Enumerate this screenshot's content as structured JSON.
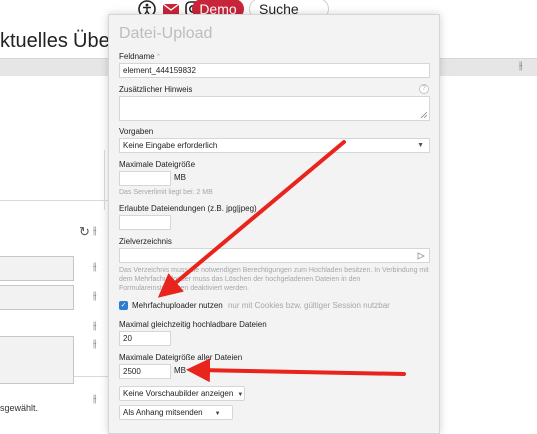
{
  "topbar": {
    "demo_label": "Demo",
    "search_label": "Suche"
  },
  "nav": {
    "item1": "ktuelles",
    "item2": "Über"
  },
  "background": {
    "selection_text": "sgewählt."
  },
  "panel": {
    "title": "Datei-Upload",
    "field_name_label": "Feldname",
    "required_mark": "*",
    "field_name_value": "element_444159832",
    "extra_hint_label": "Zusätzlicher Hinweis",
    "help_glyph": "?",
    "presets_label": "Vorgaben",
    "presets_value": "Keine Eingabe erforderlich",
    "max_size_label": "Maximale Dateigröße",
    "max_size_value": "",
    "max_size_unit": "MB",
    "server_limit_hint": "Das Serverlimit liegt bei: 2 MB",
    "extensions_label": "Erlaubte Dateiendungen (z.B. jpg|jpeg)",
    "extensions_value": "",
    "target_dir_label": "Zielverzeichnis",
    "target_dir_value": "",
    "target_dir_hint": "Das Verzeichnis muss die notwendigen Berechtigungen zum Hochladen besitzen. In Verbindung mit dem Mehrfachuploader muss das Löschen der hochgeladenen Dateien in den Formulareinstellungen deaktiviert werden.",
    "multi_upload_label": "Mehrfachuploader nutzen",
    "multi_upload_note": "nur mit Cookies bzw. gültiger Session nutzbar",
    "multi_upload_checked": true,
    "max_parallel_label": "Maximal gleichzeitig hochladbare Dateien",
    "max_parallel_value": "20",
    "max_total_label": "Maximale Dateigröße aller Dateien",
    "max_total_value": "2500",
    "max_total_unit": "MB",
    "preview_select": "Keine Vorschaubilder anzeigen",
    "attach_select": "Als Anhang mitsenden"
  },
  "colors": {
    "accent_red": "#e8241c",
    "checkbox_blue": "#2f7bd0",
    "demo_red": "#c8253a"
  }
}
